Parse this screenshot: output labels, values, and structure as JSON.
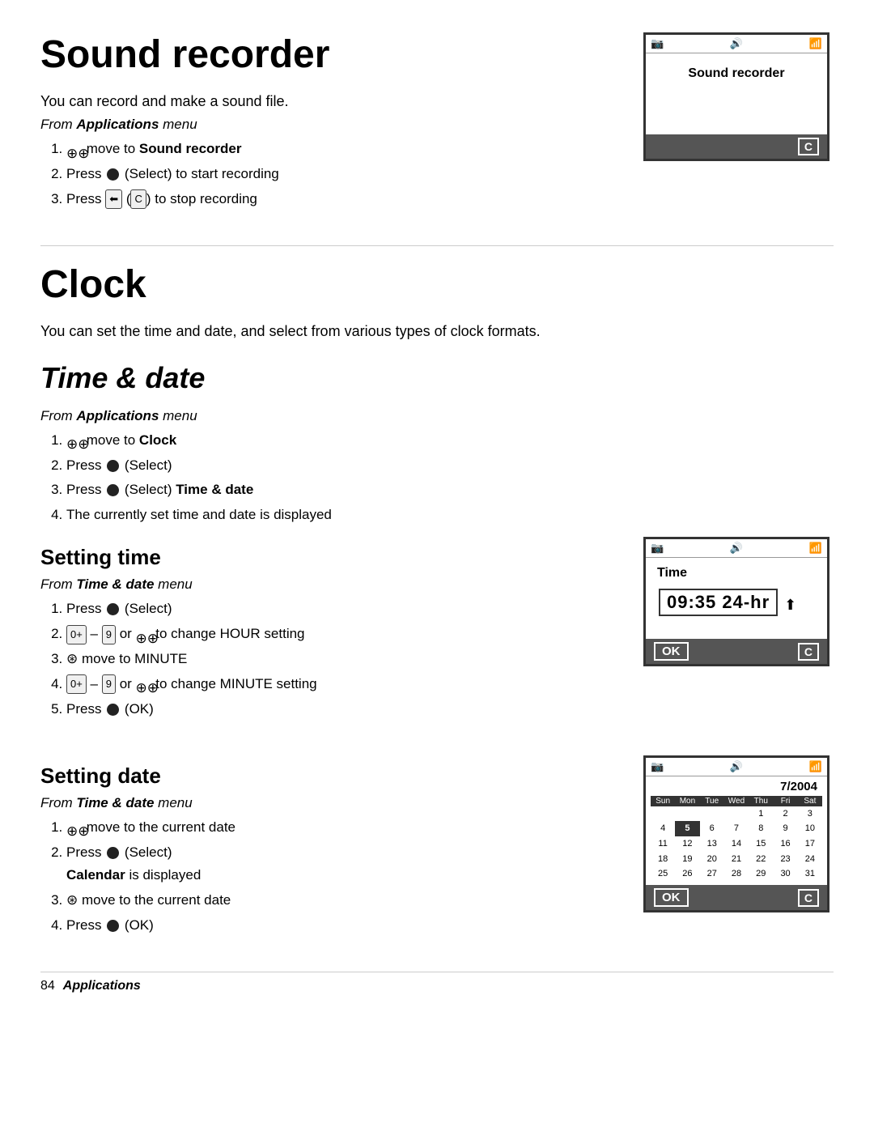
{
  "sound_recorder": {
    "title": "Sound recorder",
    "intro": "You can record and make a sound file.",
    "from_menu_label": "From ",
    "from_menu_bold": "Applications",
    "from_menu_suffix": " menu",
    "steps": [
      {
        "icon": "nav",
        "text": " move to ",
        "bold": "Sound recorder",
        "rest": ""
      },
      {
        "icon": "select",
        "text": " (Select) to start recording",
        "bold": "",
        "rest": ""
      },
      {
        "icon": "back",
        "text": " (",
        "icon2": "C",
        "rest": ") to stop recording"
      }
    ],
    "device_screen": {
      "statusbar_left": "📷",
      "statusbar_mid": "🔊",
      "statusbar_right": "📶",
      "title": "Sound recorder",
      "footer_right": "C"
    }
  },
  "clock": {
    "title": "Clock",
    "intro": "You can set the time and date, and select from various types of clock formats."
  },
  "time_date": {
    "title": "Time & date",
    "from_menu_label": "From ",
    "from_menu_bold": "Applications",
    "from_menu_suffix": " menu",
    "steps": [
      {
        "icon": "nav",
        "text": " move to ",
        "bold": "Clock",
        "rest": ""
      },
      {
        "icon": "select",
        "text": " (Select)",
        "bold": "",
        "rest": ""
      },
      {
        "icon": "select",
        "text": " (Select) ",
        "bold": "Time & date",
        "rest": ""
      },
      {
        "text": "The currently set time and date is displayed"
      }
    ]
  },
  "setting_time": {
    "title": "Setting time",
    "from_menu_bold": "Time & date",
    "from_menu_suffix": " menu",
    "steps": [
      {
        "icon": "select",
        "text": " (Select)"
      },
      {
        "key1": "0+",
        "sep": " – ",
        "key2": "9",
        "text": " or ",
        "icon": "nav",
        "text2": " to change HOUR setting"
      },
      {
        "icon": "navleft",
        "text": " move to MINUTE"
      },
      {
        "key1": "0+",
        "sep": " – ",
        "key2": "9",
        "text": " or ",
        "icon": "nav",
        "text2": " to change MINUTE setting"
      },
      {
        "icon": "select",
        "text": " (OK)"
      }
    ],
    "device_screen": {
      "label": "Time",
      "time_value": "09:35 24-hr",
      "footer_ok": "OK",
      "footer_c": "C"
    }
  },
  "setting_date": {
    "title": "Setting date",
    "from_menu_bold": "Time & date",
    "from_menu_suffix": " menu",
    "steps": [
      {
        "icon": "nav",
        "text": " move to the current date"
      },
      {
        "icon": "select",
        "text": " (Select)",
        "extra": "\n",
        "bold_extra": "Calendar",
        "rest_extra": " is displayed"
      },
      {
        "icon": "navleft",
        "text": " move to the current date"
      },
      {
        "icon": "select",
        "text": " (OK)"
      }
    ],
    "device_screen": {
      "month_year": "7/2004",
      "days": [
        "Sun",
        "Mon",
        "Tue",
        "Wed",
        "Thu",
        "Fri",
        "Sat"
      ],
      "weeks": [
        [
          "",
          "",
          "",
          "",
          "1",
          "2",
          "3"
        ],
        [
          "4",
          "5",
          "6",
          "7",
          "8",
          "9",
          "10"
        ],
        [
          "11",
          "12",
          "13",
          "14",
          "15",
          "16",
          "17"
        ],
        [
          "18",
          "19",
          "20",
          "21",
          "22",
          "23",
          "24"
        ],
        [
          "25",
          "26",
          "27",
          "28",
          "29",
          "30",
          "31"
        ]
      ],
      "highlighted_date": "5",
      "footer_ok": "OK",
      "footer_c": "C"
    }
  },
  "footer": {
    "page_number": "84",
    "section_name": "Applications"
  }
}
